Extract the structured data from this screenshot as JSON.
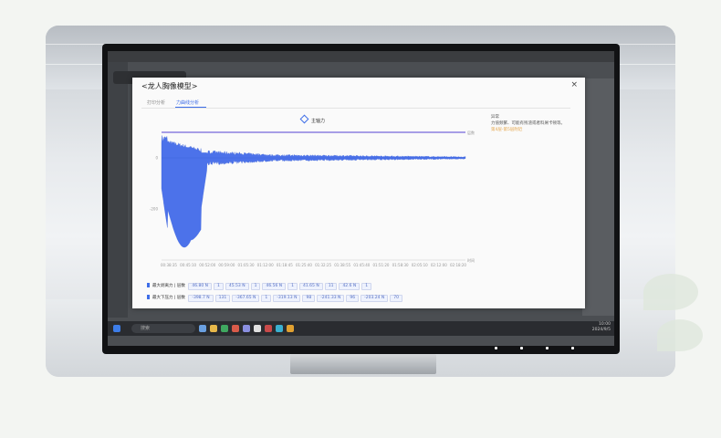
{
  "modal": {
    "title": "<龙人胸像模型>",
    "close": "×",
    "tabs": [
      "打印分析",
      "力曲线分析"
    ],
    "active_tab": 1,
    "legend": "主轴力",
    "sidebar": {
      "heading": "异常",
      "text": "力值频繁、可能有残渣或者料屑卡顿等。",
      "warn": "第4层-第5层附近"
    },
    "rows": [
      {
        "label": "最大剥离力 | 层数",
        "pills": [
          "46.80 N",
          "1",
          "45.53 N",
          "1",
          "46.56 N",
          "1",
          "41.65 N",
          "11",
          "42.6 N",
          "1"
        ]
      },
      {
        "label": "最大下压力 | 层数",
        "pills": [
          "-398.7 N",
          "131",
          "-367.65 N",
          "1",
          "-319.13 N",
          "98",
          "-241.33 N",
          "96",
          "-203.24 N",
          "70"
        ]
      }
    ]
  },
  "taskbar": {
    "search_placeholder": "搜索",
    "time": "10:00",
    "date": "2024/9/5"
  },
  "chart_data": {
    "type": "area",
    "series": [
      {
        "name": "主轴力"
      }
    ],
    "x_tick_labels": [
      "00:38:35",
      "00:45:10",
      "00:52:00",
      "00:59:00",
      "01:05:30",
      "01:12:00",
      "01:18:45",
      "01:25:40",
      "01:32:25",
      "01:38:55",
      "01:45:40",
      "01:51:20",
      "01:58:30",
      "02:05:10",
      "02:12:00",
      "02:18:20"
    ],
    "top_axis_label": "层数",
    "bottom_axis_label": "时间",
    "y_ticks": [
      200,
      0,
      -200
    ],
    "ylim": [
      -400,
      100
    ],
    "grid": false,
    "legend_position": "top"
  }
}
